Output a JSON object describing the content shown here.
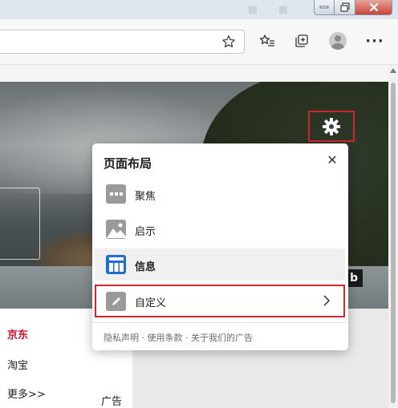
{
  "window": {
    "controls": [
      "minimize",
      "maximize",
      "close"
    ]
  },
  "toolbar": {
    "address_value": "",
    "icons": [
      "star-icon",
      "favorites-icon",
      "collections-icon",
      "profile-icon",
      "more-icon"
    ],
    "more_label": "···"
  },
  "hero": {
    "bing_label": "b"
  },
  "popup": {
    "title": "页面布局",
    "close_label": "✕",
    "options": [
      {
        "label": "聚焦",
        "selected": false
      },
      {
        "label": "启示",
        "selected": false
      },
      {
        "label": "信息",
        "selected": true
      }
    ],
    "custom_label": "自定义",
    "footer": "隐私声明 · 使用条款 · 关于我们的广告"
  },
  "links": {
    "jd": "京东",
    "taobao": "淘宝",
    "more": "更多>>",
    "ad": "广告"
  },
  "colors": {
    "highlight_red": "#d0262f",
    "selected_blue": "#1f6fcf",
    "jd_red": "#c8102e"
  }
}
